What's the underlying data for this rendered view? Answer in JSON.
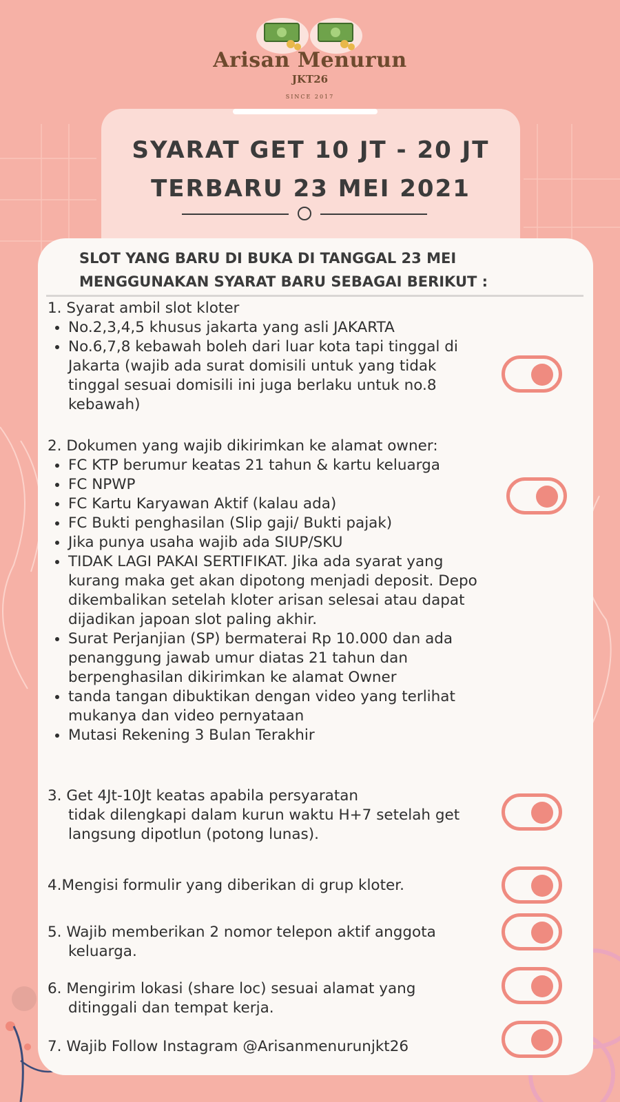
{
  "colors": {
    "background": "#f6b1a6",
    "card": "#fbf8f5",
    "title_card": "#fbdcd6",
    "accent": "#ef8b80",
    "text": "#3b3b3b",
    "logo_text": "#6e4a2e"
  },
  "logo": {
    "title": "Arisan Menurun",
    "subtitle": "JKT26",
    "since": "SINCE 2017",
    "icon": "money-stack-icon"
  },
  "heading": {
    "line1": "SYARAT GET 10 JT - 20 JT",
    "line2": "TERBARU 23 MEI 2021"
  },
  "intro": {
    "line1": "SLOT YANG BARU DI BUKA DI TANGGAL 23 MEI",
    "line2": "MENGGUNAKAN SYARAT BARU SEBAGAI BERIKUT :"
  },
  "rules": [
    {
      "head": "1. Syarat ambil slot kloter",
      "bullets": [
        "No.2,3,4,5 khusus jakarta yang asli JAKARTA",
        "No.6,7,8 kebawah boleh dari luar kota tapi tinggal di Jakarta (wajib ada surat domisili untuk yang tidak tinggal sesuai domisili ini juga berlaku untuk no.8 kebawah)"
      ]
    },
    {
      "head": "2. Dokumen yang wajib dikirimkan ke alamat owner:",
      "bullets": [
        "FC KTP berumur keatas 21 tahun & kartu keluarga",
        "FC NPWP",
        "FC Kartu Karyawan Aktif (kalau ada)",
        "FC Bukti penghasilan (Slip gaji/ Bukti pajak)",
        "Jika punya usaha wajib ada SIUP/SKU",
        "TIDAK LAGI PAKAI SERTIFIKAT. Jika ada syarat yang kurang maka get akan dipotong menjadi deposit. Depo dikembalikan setelah kloter arisan selesai atau dapat dijadikan japoan slot paling akhir.",
        "Surat Perjanjian (SP) bermaterai Rp 10.000 dan ada penanggung jawab umur diatas 21 tahun dan berpenghasilan dikirimkan ke alamat Owner",
        "tanda tangan dibuktikan dengan video yang terlihat mukanya dan video pernyataan",
        "Mutasi Rekening 3 Bulan Terakhir"
      ]
    },
    {
      "head": "3. Get 4Jt-10Jt keatas apabila persyaratan",
      "cont": "tidak dilengkapi dalam kurun waktu H+7 setelah get langsung dipotlun (potong lunas)."
    },
    {
      "head": "4.Mengisi formulir yang diberikan di grup kloter."
    },
    {
      "head": "5. Wajib memberikan 2 nomor telepon aktif anggota",
      "cont": "keluarga."
    },
    {
      "head": "6. Mengirim lokasi (share loc) sesuai  alamat yang",
      "cont": "ditinggali dan tempat kerja."
    },
    {
      "head": "7. Wajib Follow Instagram  @Arisanmenurunjkt26"
    }
  ],
  "toggles": [
    {
      "name": "rule-1-toggle",
      "state": "on"
    },
    {
      "name": "rule-2-toggle",
      "state": "on"
    },
    {
      "name": "rule-3-toggle",
      "state": "on"
    },
    {
      "name": "rule-4-toggle",
      "state": "on"
    },
    {
      "name": "rule-5-toggle",
      "state": "on"
    },
    {
      "name": "rule-6-toggle",
      "state": "on"
    },
    {
      "name": "rule-7-toggle",
      "state": "on"
    }
  ]
}
